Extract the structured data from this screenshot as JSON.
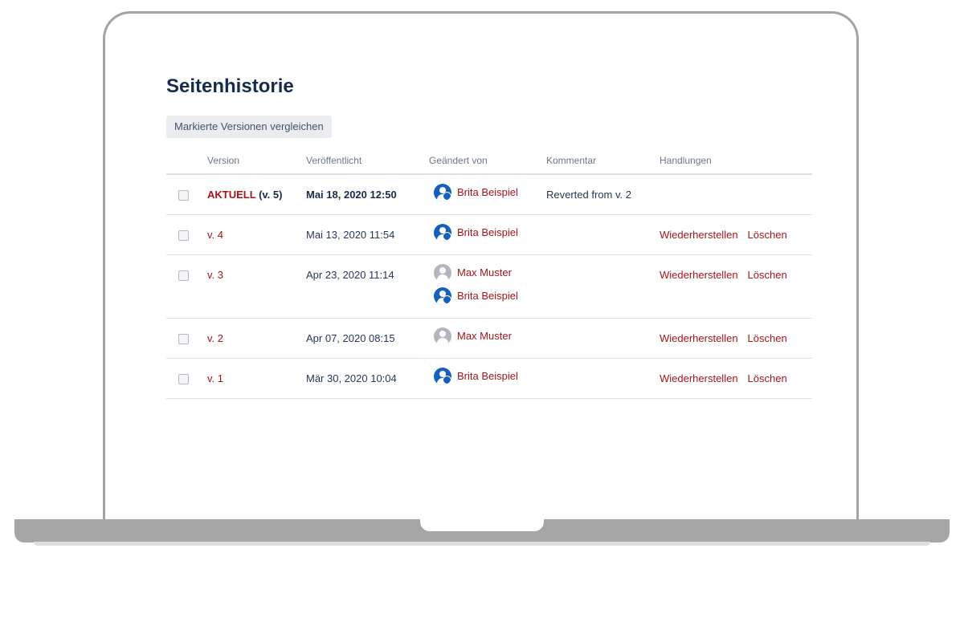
{
  "page": {
    "title": "Seitenhistorie",
    "compare_button": "Markierte Versionen vergleichen"
  },
  "table": {
    "headers": {
      "version": "Version",
      "published": "Veröffentlicht",
      "changed_by": "Geändert von",
      "comment": "Kommentar",
      "actions": "Handlungen"
    },
    "actions": {
      "restore": "Wiederherstellen",
      "delete": "Löschen"
    },
    "rows": [
      {
        "version_label": "AKTUELL",
        "version_suffix": "(v. 5)",
        "published": "Mai 18, 2020 12:50",
        "authors": [
          "Brita Beispiel"
        ],
        "comment": "Reverted from v. 2"
      },
      {
        "version_label": "v. 4",
        "published": "Mai 13, 2020 11:54",
        "authors": [
          "Brita Beispiel"
        ],
        "comment": ""
      },
      {
        "version_label": "v. 3",
        "published": "Apr 23, 2020 11:14",
        "authors": [
          "Max Muster",
          "Brita Beispiel"
        ],
        "comment": ""
      },
      {
        "version_label": "v. 2",
        "published": "Apr 07, 2020 08:15",
        "authors": [
          "Max Muster"
        ],
        "comment": ""
      },
      {
        "version_label": "v. 1",
        "published": "Mär 30, 2020 10:04",
        "authors": [
          "Brita Beispiel"
        ],
        "comment": ""
      }
    ]
  },
  "icons": {
    "avatar_brita": "user-avatar-icon",
    "avatar_max": "default-avatar-icon"
  },
  "colors": {
    "link": "#a3151a",
    "avatar_blue": "#1560bd",
    "avatar_grey": "#b3b6bd"
  }
}
